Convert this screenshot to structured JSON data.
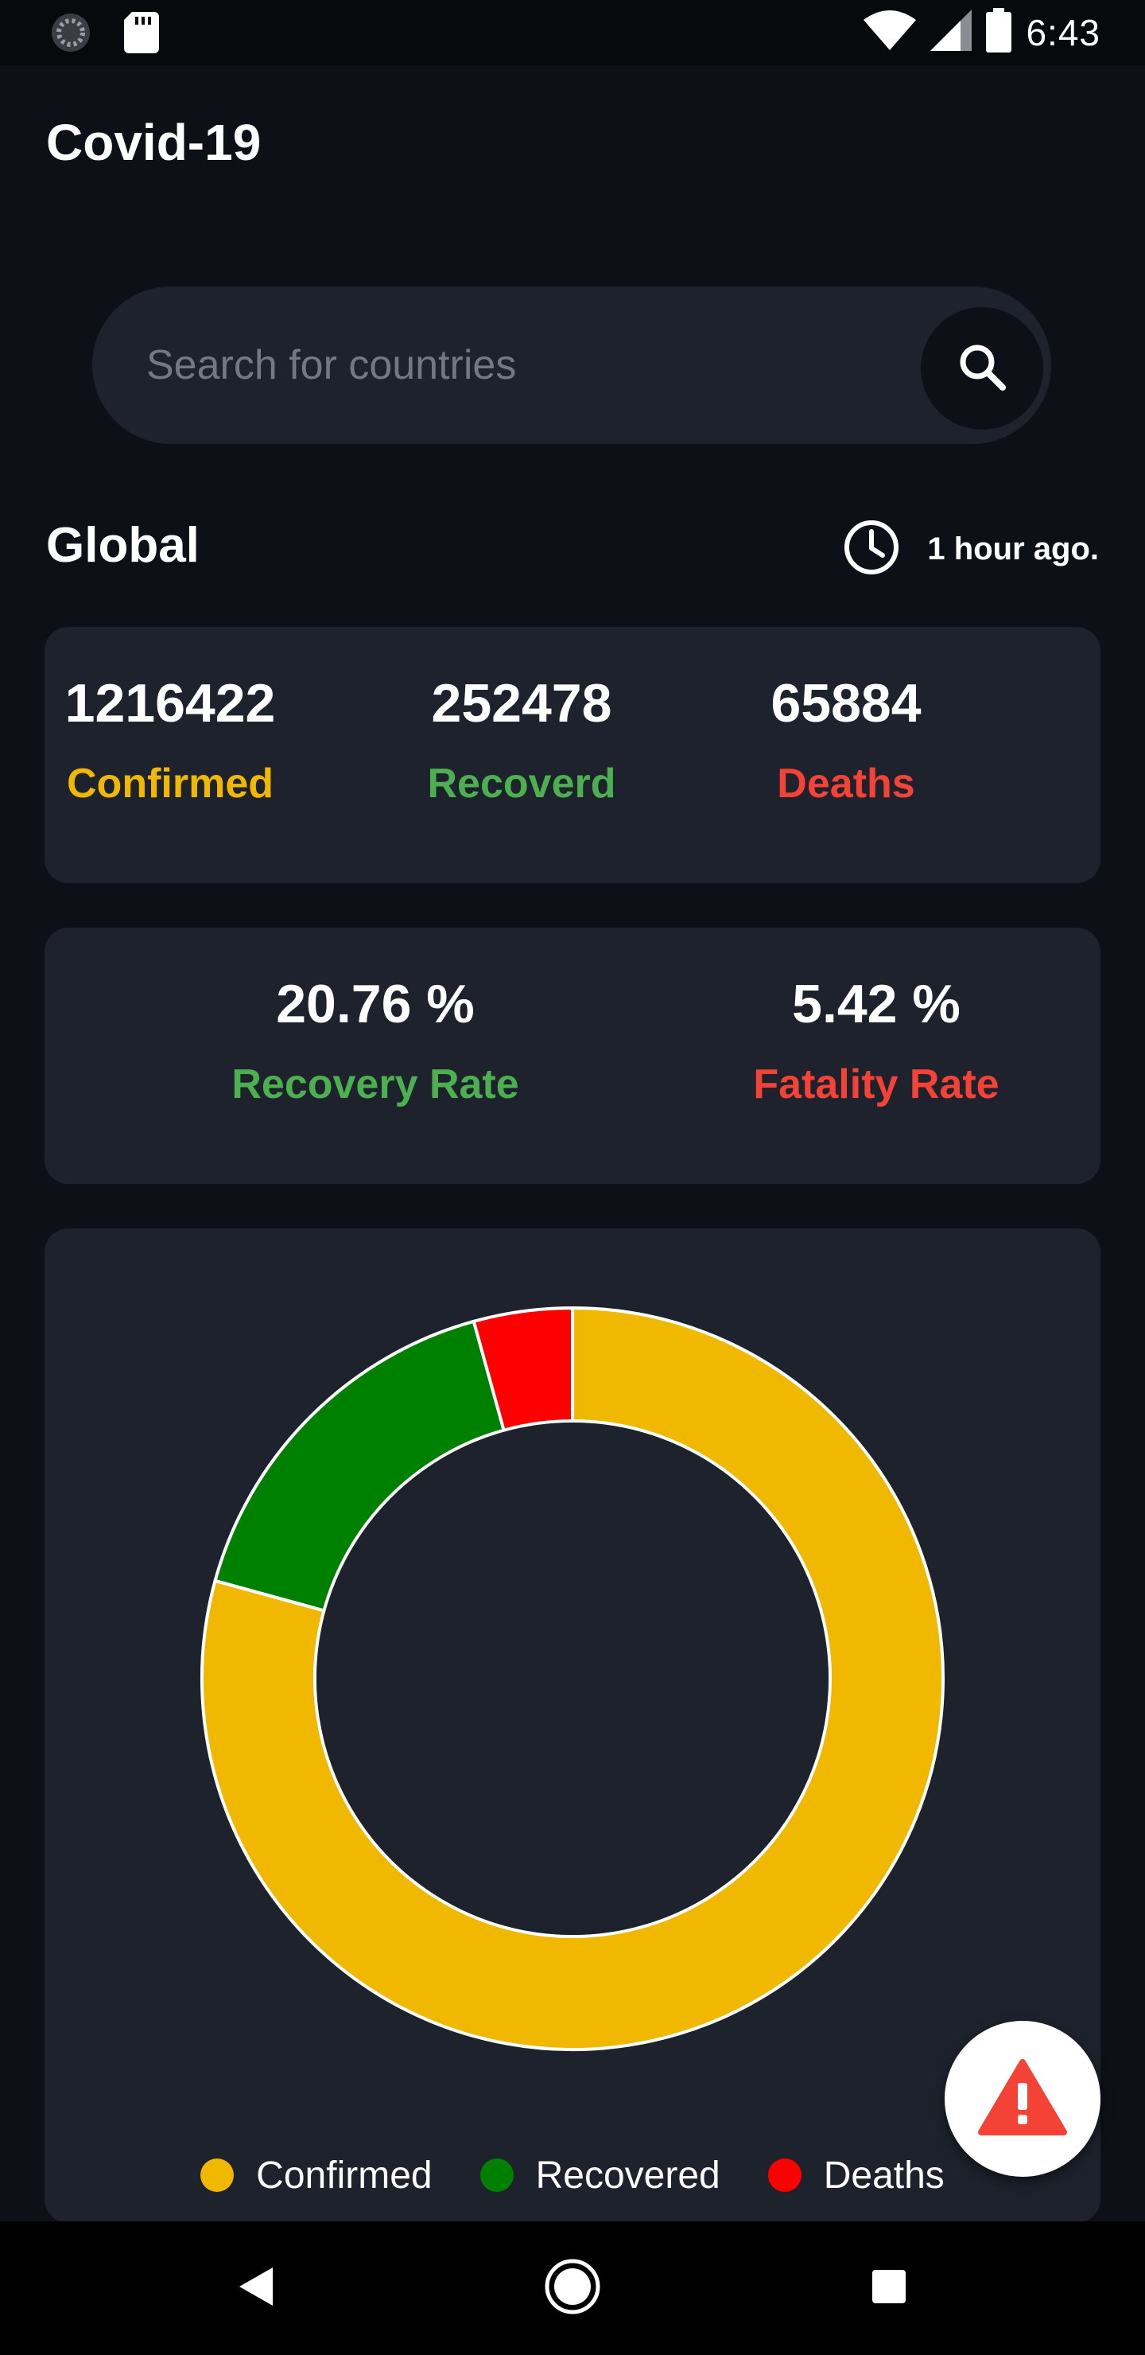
{
  "status_bar": {
    "time": "6:43",
    "left_icons": [
      "loading-icon",
      "sd-card-icon"
    ],
    "right_icons": [
      "wifi-icon",
      "cell-signal-icon",
      "battery-icon"
    ]
  },
  "header": {
    "title": "Covid-19"
  },
  "search": {
    "placeholder": "Search for countries",
    "value": "",
    "icon": "search-icon"
  },
  "global": {
    "title": "Global",
    "updated_text": "1 hour ago.",
    "updated_icon": "clock-icon"
  },
  "stats": [
    {
      "value": "1216422",
      "label": "Confirmed",
      "color": "#f0b800"
    },
    {
      "value": "252478",
      "label": "Recoverd",
      "color": "#4caf50"
    },
    {
      "value": "65884",
      "label": "Deaths",
      "color": "#f44336"
    }
  ],
  "rates": [
    {
      "value": "20.76 %",
      "label": "Recovery Rate",
      "color": "#4caf50"
    },
    {
      "value": "5.42 %",
      "label": "Fatality Rate",
      "color": "#f44336"
    }
  ],
  "chart_data": {
    "type": "pie",
    "donut": true,
    "start_angle_deg": 0,
    "categories": [
      "Confirmed",
      "Recovered",
      "Deaths"
    ],
    "values": [
      1216422,
      252478,
      65884
    ],
    "colors": [
      "#f0b800",
      "#008000",
      "#ff0000"
    ],
    "legend_position": "bottom"
  },
  "fab": {
    "icon": "warning-icon",
    "color": "#f44336"
  },
  "nav_bar": {
    "icons": [
      "back-icon",
      "home-icon",
      "recents-icon"
    ]
  }
}
